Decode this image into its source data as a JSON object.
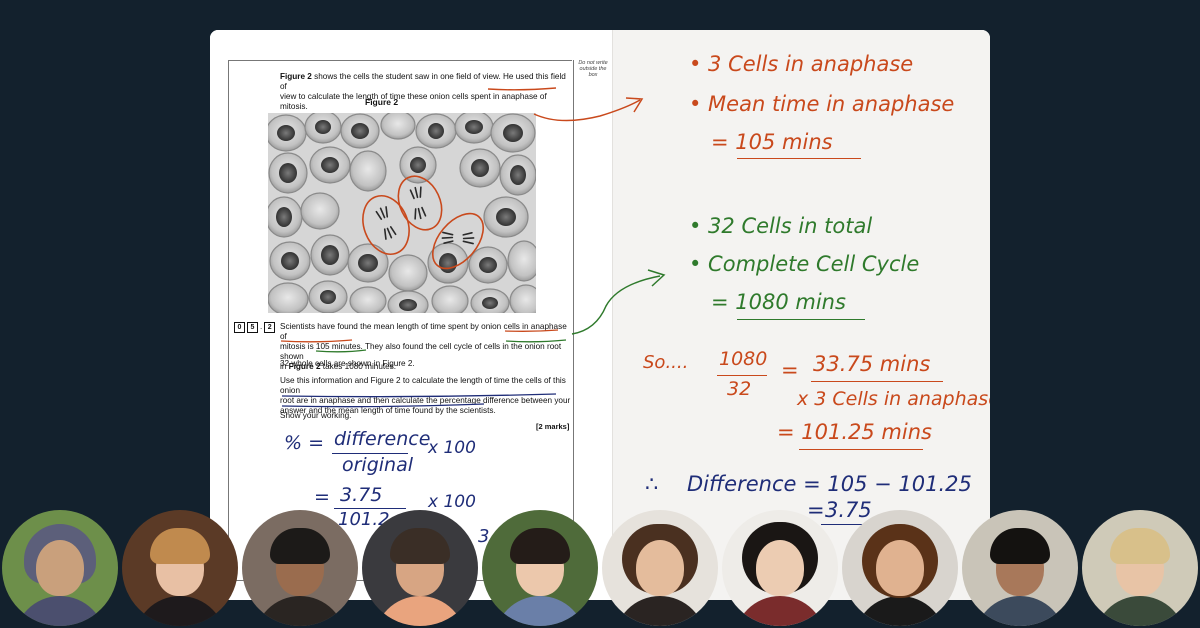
{
  "exam": {
    "margin_note": "Do not write outside the box",
    "intro_line1_bold": "Figure 2",
    "intro_line1_rest": " shows the cells the student saw in one field of view.  He used this field of",
    "intro_line2": "view to calculate the length of time these onion cells spent in anaphase of mitosis.",
    "figure_title": "Figure 2",
    "question_digits": [
      "0",
      "5",
      "2"
    ],
    "question_dot": ".",
    "q_text_l1": "Scientists have found the mean length of time spent by onion cells in anaphase of",
    "q_text_l2": "mitosis is 105 minutes. They also found the cell cycle of cells in the onion root shown",
    "q_text_l3_pre": "in ",
    "q_text_l3_bold": "Figure 2",
    "q_text_l3_post": " takes 1080 minutes.",
    "whole_cells": "32 whole cells are shown in Figure 2.",
    "use_l1": "Use this information and Figure 2 to calculate the length of time the cells of this onion",
    "use_l2": "root are in anaphase and then calculate the percentage difference between your",
    "use_l3": "answer and the mean length of time found by the scientists.",
    "show_working": "Show your working.",
    "marks": "[2 marks]"
  },
  "working_left": {
    "pct": "% =",
    "difference": "difference",
    "original": "original",
    "times100a": "x 100",
    "eq": "=",
    "num375": "3.75",
    "times100b": "x 100",
    "den_partial": "101.2",
    "trail": "3"
  },
  "notes_right": {
    "b1": "•  3  Cells  in  anaphase",
    "b2": "•  Mean  time  in  anaphase",
    "b3": "=  105  mins",
    "b4": "•  32  Cells  in  total",
    "b5": "•  Complete  Cell  Cycle",
    "b6": "=  1080  mins",
    "so": "So....",
    "frac_num": "1080",
    "frac_den": "32",
    "eq1": "=",
    "r1": "33.75 mins",
    "r2": "x  3  Cells  in anaphase",
    "r3": "=  101.25 mins",
    "therefore": "∴",
    "diff": "Difference  =  105 − 101.25",
    "diff2_eq": "=",
    "diff2": "3.75"
  },
  "colors": {
    "background": "#13212d",
    "orange": "#c9491c",
    "green": "#2f7a2c",
    "blue": "#1f2d78"
  },
  "participants": [
    "avatar-1",
    "avatar-2",
    "avatar-3",
    "avatar-4",
    "avatar-5",
    "avatar-6",
    "avatar-7",
    "avatar-8",
    "avatar-9",
    "avatar-10"
  ]
}
